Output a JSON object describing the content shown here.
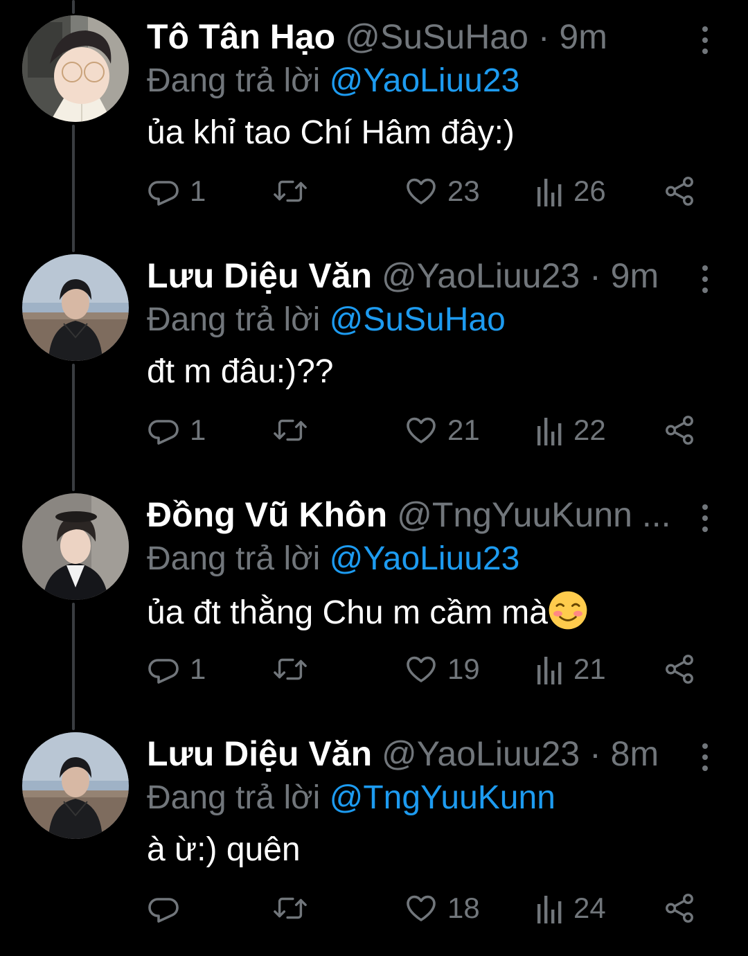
{
  "replying_prefix": "Đang trả lời",
  "colors": {
    "background": "#000000",
    "name": "#ffffff",
    "secondary": "#71767b",
    "mention": "#1d9bf0",
    "thread_line": "#3a3d41"
  },
  "icons": {
    "reply": "reply-icon",
    "retweet": "retweet-icon",
    "like": "heart-icon",
    "views": "views-icon",
    "share": "share-icon",
    "more": "more-vertical-icon",
    "emoji": "smiling-face-emoji"
  },
  "tweets": [
    {
      "name": "Tô Tân Hạo",
      "handle": "@SuSuHao",
      "dot": "·",
      "time": "9m",
      "replying_to": "@YaoLiuu23",
      "text": "ủa khỉ tao Chí Hâm đây:)",
      "replies": "1",
      "retweets": "",
      "likes": "23",
      "views": "26"
    },
    {
      "name": "Lưu Diệu Văn",
      "handle": "@YaoLiuu23",
      "dot": "·",
      "time": "9m",
      "replying_to": "@SuSuHao",
      "text": "đt m đâu:)??",
      "replies": "1",
      "retweets": "",
      "likes": "21",
      "views": "22"
    },
    {
      "name": "Đồng Vũ Khôn",
      "handle": "@TngYuuKunn",
      "ellipsis": "...",
      "replying_to": "@YaoLiuu23",
      "text": "ủa đt thằng Chu m cầm mà",
      "emoji": "☺️",
      "replies": "1",
      "retweets": "",
      "likes": "19",
      "views": "21"
    },
    {
      "name": "Lưu Diệu Văn",
      "handle": "@YaoLiuu23",
      "dot": "·",
      "time": "8m",
      "replying_to": "@TngYuuKunn",
      "text": "à ừ:) quên",
      "replies": "",
      "retweets": "",
      "likes": "18",
      "views": "24"
    }
  ]
}
